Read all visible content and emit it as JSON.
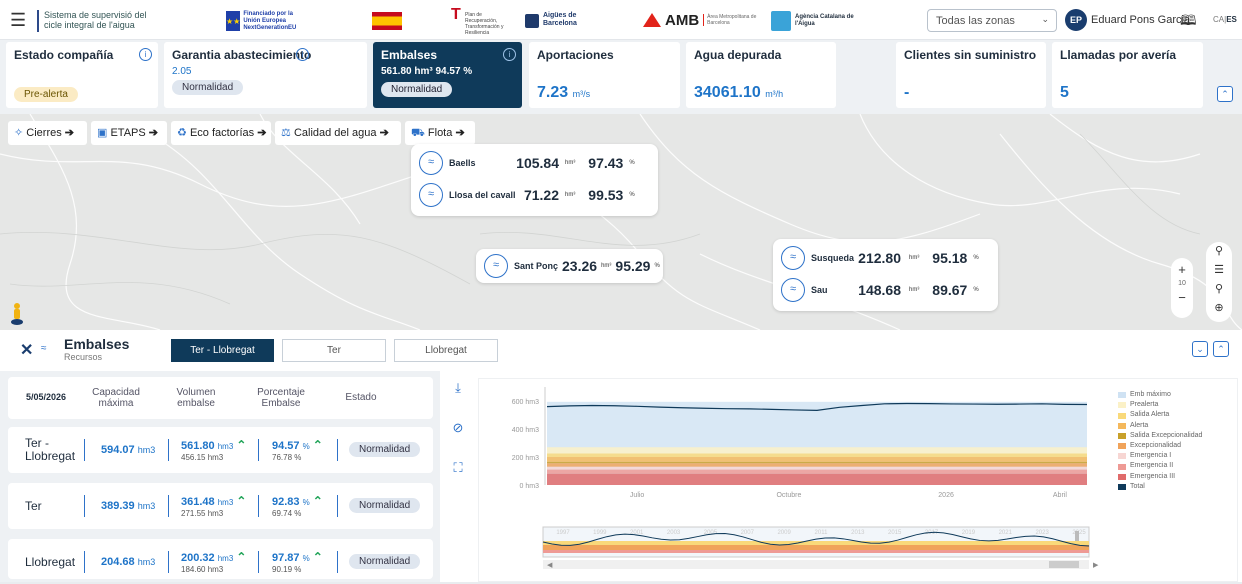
{
  "header": {
    "menu_icon": "hamburger-icon",
    "system_title": "Sistema de supervisió del cicle integral de l'aigua",
    "logos": {
      "eu": "Financiado por la Unión Europea NextGenerationEU",
      "spain": "Gobierno de España",
      "transicion": "Plan de Recuperación, Transformación y Resiliencia",
      "aigues": "Aigües de Barcelona",
      "amb": "AMB",
      "amb_sub": "Àrea Metropolitana de Barcelona",
      "aca": "Agència Catalana de l'Aigua"
    },
    "zone_select": "Todas las zonas",
    "user_initials": "EP",
    "user_name": "Eduard Pons Garcia",
    "lang_ca": "CA",
    "lang_es": "ES"
  },
  "cards": {
    "estado": {
      "title": "Estado compañía",
      "badge": "Pre-alerta"
    },
    "garantia": {
      "title": "Garantia abastecimiento",
      "value": "2.05",
      "badge": "Normalidad"
    },
    "embalses": {
      "title": "Embalses",
      "value": "561.80 hm³",
      "pct": "94.57 %",
      "badge": "Normalidad"
    },
    "aportaciones": {
      "title": "Aportaciones",
      "value": "7.23",
      "unit": "m³/s"
    },
    "agua": {
      "title": "Agua depurada",
      "value": "34061.10",
      "unit": "m³/h"
    },
    "clientes": {
      "title": "Clientes sin suministro",
      "value": "-"
    },
    "llamadas": {
      "title": "Llamadas por avería",
      "value": "5"
    }
  },
  "layers": [
    {
      "label": "Cierres",
      "icon": "valve-icon"
    },
    {
      "label": "ETAPS",
      "icon": "plant-icon"
    },
    {
      "label": "Eco factorías",
      "icon": "eco-icon"
    },
    {
      "label": "Calidad del agua",
      "icon": "flask-icon"
    },
    {
      "label": "Flota",
      "icon": "truck-icon"
    }
  ],
  "map_reservoirs": {
    "baells": {
      "name": "Baells",
      "vol": "105.84",
      "unit": "hm³",
      "pct": "97.43",
      "pu": "%"
    },
    "llosa": {
      "name": "Llosa del cavall",
      "vol": "71.22",
      "unit": "hm³",
      "pct": "99.53",
      "pu": "%"
    },
    "sant": {
      "name": "Sant Ponç",
      "vol": "23.26",
      "unit": "hm³",
      "pct": "95.29",
      "pu": "%"
    },
    "susqueda": {
      "name": "Susqueda",
      "vol": "212.80",
      "unit": "hm³",
      "pct": "95.18",
      "pu": "%"
    },
    "sau": {
      "name": "Sau",
      "vol": "148.68",
      "unit": "hm³",
      "pct": "89.67",
      "pu": "%"
    }
  },
  "map_zoom": "10",
  "panel": {
    "title": "Embalses",
    "subtitle": "Recursos",
    "tabs": [
      "Ter - Llobregat",
      "Ter",
      "Llobregat"
    ],
    "date": "5/05/2026",
    "col_cap": "Capacidad máxima",
    "col_vol": "Volumen embalse",
    "col_pct": "Porcentaje Embalse",
    "col_estado": "Estado",
    "rows": [
      {
        "name": "Ter - Llobregat",
        "cap": "594.07",
        "vol": "561.80",
        "vol_prev": "456.15 hm3",
        "pct": "94.57",
        "pct_prev": "76.78 %",
        "estado": "Normalidad"
      },
      {
        "name": "Ter",
        "cap": "389.39",
        "vol": "361.48",
        "vol_prev": "271.55 hm3",
        "pct": "92.83",
        "pct_prev": "69.74 %",
        "estado": "Normalidad"
      },
      {
        "name": "Llobregat",
        "cap": "204.68",
        "vol": "200.32",
        "vol_prev": "184.60 hm3",
        "pct": "97.87",
        "pct_prev": "90.19 %",
        "estado": "Normalidad"
      }
    ],
    "unit_hm": "hm3",
    "unit_pct": "%"
  },
  "chart_data": {
    "type": "area",
    "ylabels": [
      "600 hm3",
      "400 hm3",
      "200 hm3",
      "0 hm3"
    ],
    "xlabels": [
      "Julio",
      "Octubre",
      "2026",
      "Abril"
    ],
    "ylim": [
      0,
      700
    ],
    "total_series": [
      560,
      565,
      568,
      566,
      562,
      556,
      552,
      548,
      545,
      544,
      540,
      536,
      533,
      555,
      568,
      580,
      582,
      581,
      579,
      578,
      577,
      578,
      580,
      576,
      575
    ],
    "emb_max": 594,
    "levels": [
      {
        "name": "Emb máximo",
        "color": "#cfe2f3"
      },
      {
        "name": "Prealerta",
        "color": "#fbf1c7"
      },
      {
        "name": "Salida Alerta",
        "color": "#f9d97a"
      },
      {
        "name": "Alerta",
        "color": "#f4b85c"
      },
      {
        "name": "Salida Excepcionalidad",
        "color": "#c8a02a"
      },
      {
        "name": "Excepcionalidad",
        "color": "#f0a35a"
      },
      {
        "name": "Emergencia I",
        "color": "#f7d6d3"
      },
      {
        "name": "Emergencia II",
        "color": "#ee9a95"
      },
      {
        "name": "Emergencia III",
        "color": "#e06b6b"
      },
      {
        "name": "Total",
        "color": "#0f3a5a"
      }
    ],
    "navigator_years": [
      "1997",
      "1999",
      "2001",
      "2003",
      "2005",
      "2007",
      "2009",
      "2011",
      "2013",
      "2015",
      "2017",
      "2019",
      "2021",
      "2023",
      "2025"
    ]
  }
}
